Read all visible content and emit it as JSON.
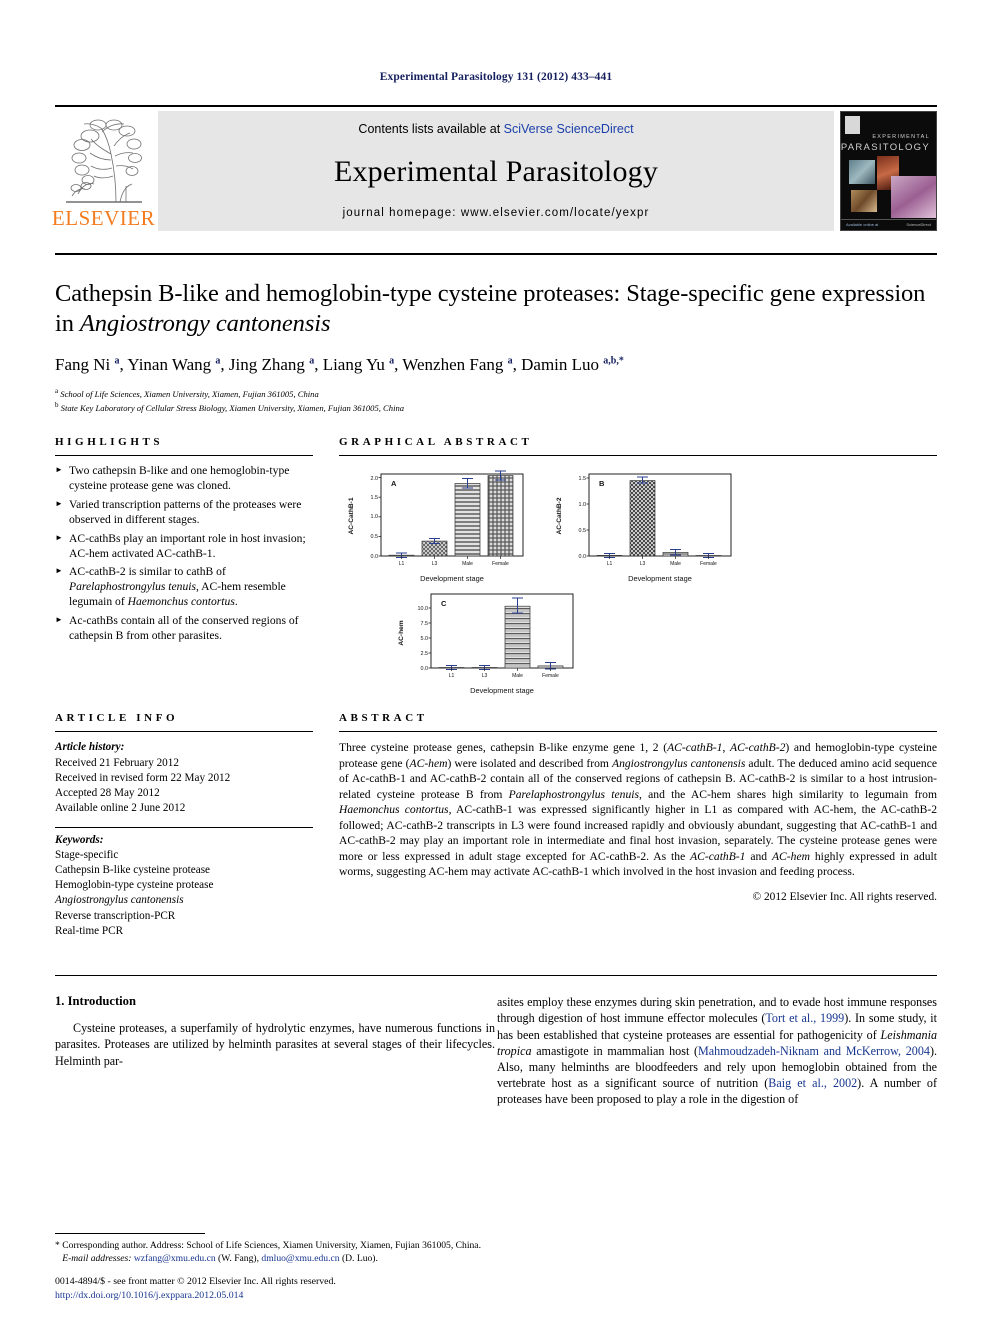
{
  "running_head": "Experimental Parasitology 131 (2012) 433–441",
  "masthead": {
    "contents_prefix": "Contents lists available at ",
    "contents_link": "SciVerse ScienceDirect",
    "journal_name": "Experimental Parasitology",
    "homepage": "journal homepage: www.elsevier.com/locate/yexpr",
    "publisher_logo_text": "ELSEVIER",
    "cover_line1": "EXPERIMENTAL",
    "cover_line2": "PARASITOLOGY",
    "cover_footer_left": "Available online at",
    "cover_footer_right": "ScienceDirect",
    "link_color": "#1a3faa",
    "logo_color": "#f47c20",
    "panel_bg": "#e6e6e6"
  },
  "article": {
    "title_part1": "Cathepsin B-like and hemoglobin-type cysteine proteases: Stage-specific gene expression in ",
    "title_italic": "Angiostrongy cantonensis",
    "authors": "Fang Ni a, Yinan Wang a, Jing Zhang a, Liang Yu a, Wenzhen Fang a, Damin Luo a,b,*",
    "affiliation_a": "School of Life Sciences, Xiamen University, Xiamen, Fujian 361005, China",
    "affiliation_b": "State Key Laboratory of Cellular Stress Biology, Xiamen University, Xiamen, Fujian 361005, China"
  },
  "highlights": {
    "heading": "HIGHLIGHTS",
    "items": [
      "Two cathepsin B-like and one hemoglobin-type cysteine protease gene was cloned.",
      "Varied transcription patterns of the proteases were observed in different stages.",
      "AC-cathBs play an important role in host invasion; AC-hem activated AC-cathB-1.",
      "AC-cathB-2 is similar to cathB of Parelaphostrongylus tenuis, AC-hem resemble legumain of Haemonchus contortus.",
      "Ac-cathBs contain all of the conserved regions of cathepsin B from other parasites."
    ]
  },
  "graphical_abstract": {
    "heading": "GRAPHICAL ABSTRACT"
  },
  "chart_data": [
    {
      "type": "bar",
      "panel": "A",
      "title": "",
      "xlabel": "Development stage",
      "ylabel": "AC-CathB-1",
      "categories": [
        "L1",
        "L3",
        "Male",
        "Female"
      ],
      "values": [
        0.02,
        0.38,
        1.85,
        2.05
      ],
      "errors": [
        0.03,
        0.06,
        0.12,
        0.12
      ],
      "ylim": [
        0.0,
        2.3
      ],
      "yticks": [
        0.0,
        0.5,
        1.0,
        1.5,
        2.0
      ],
      "ytick_labels": [
        "0.0",
        "0.5",
        "1.0",
        "1.5",
        "2.0"
      ],
      "grid": false,
      "legend": "none"
    },
    {
      "type": "bar",
      "panel": "B",
      "title": "",
      "xlabel": "Development stage",
      "ylabel": "AC-CathB-2",
      "categories": [
        "L1",
        "L3",
        "Male",
        "Female"
      ],
      "values": [
        0.01,
        1.45,
        0.07,
        0.01
      ],
      "errors": [
        0.02,
        0.05,
        0.03,
        0.02
      ],
      "ylim": [
        0.0,
        1.65
      ],
      "yticks": [
        0.0,
        0.5,
        1.0,
        1.5
      ],
      "ytick_labels": [
        "0.0",
        "0.5",
        "1.0",
        "1.5"
      ],
      "grid": false,
      "legend": "none"
    },
    {
      "type": "bar",
      "panel": "C",
      "title": "",
      "xlabel": "Development stage",
      "ylabel": "AC-hem",
      "categories": [
        "L1",
        "L3",
        "Male",
        "Female"
      ],
      "values": [
        0.02,
        0.02,
        10.3,
        0.35
      ],
      "errors": [
        0.05,
        0.05,
        0.9,
        0.25
      ],
      "ylim": [
        0.0,
        12.5
      ],
      "yticks": [
        0.0,
        2.5,
        5.0,
        7.5,
        10.0
      ],
      "ytick_labels": [
        "0.0",
        "2.5",
        "5.0",
        "7.5",
        "10.0"
      ],
      "grid": false,
      "legend": "none"
    }
  ],
  "article_info": {
    "heading": "ARTICLE INFO",
    "history_label": "Article history:",
    "history": [
      "Received 21 February 2012",
      "Received in revised form 22 May 2012",
      "Accepted 28 May 2012",
      "Available online 2 June 2012"
    ],
    "keywords_label": "Keywords:",
    "keywords": [
      "Stage-specific",
      "Cathepsin B-like cysteine protease",
      "Hemoglobin-type cysteine protease",
      "Angiostrongylus cantonensis",
      "Reverse transcription-PCR",
      "Real-time PCR"
    ],
    "keyword_italic_index": 3
  },
  "abstract": {
    "heading": "ABSTRACT",
    "text": "Three cysteine protease genes, cathepsin B-like enzyme gene 1, 2 (AC-cathB-1, AC-cathB-2) and hemoglobin-type cysteine protease gene (AC-hem) were isolated and described from Angiostrongylus cantonensis adult. The deduced amino acid sequence of Ac-cathB-1 and AC-cathB-2 contain all of the conserved regions of cathepsin B. AC-cathB-2 is similar to a host intrusion-related cysteine protease B from Parelaphostrongylus tenuis, and the AC-hem shares high similarity to legumain from Haemonchus contortus, AC-cathB-1 was expressed significantly higher in L1 as compared with AC-hem, the AC-cathB-2 followed; AC-cathB-2 transcripts in L3 were found increased rapidly and obviously abundant, suggesting that AC-cathB-1 and AC-cathB-2 may play an important role in intermediate and final host invasion, separately. The cysteine protease genes were more or less expressed in adult stage excepted for AC-cathB-2. As the AC-cathB-1 and AC-hem highly expressed in adult worms, suggesting AC-hem may activate AC-cathB-1 which involved in the host invasion and feeding process.",
    "copyright": "© 2012 Elsevier Inc. All rights reserved."
  },
  "introduction": {
    "heading": "1. Introduction",
    "left_paragraph": "Cysteine proteases, a superfamily of hydrolytic enzymes, have numerous functions in parasites. Proteases are utilized by helminth parasites at several stages of their lifecycles. Helminth par-",
    "right_paragraph": "asites employ these enzymes during skin penetration, and to evade host immune responses through digestion of host immune effector molecules (Tort et al., 1999). In some study, it has been established that cysteine proteases are essential for pathogenicity of Leishmania tropica amastigote in mammalian host (Mahmoudzadeh-Niknam and McKerrow, 2004). Also, many helminths are bloodfeeders and rely upon hemoglobin obtained from the vertebrate host as a significant source of nutrition (Baig et al., 2002). A number of proteases have been proposed to play a role in the digestion of"
  },
  "footnote": {
    "corresponding": "* Corresponding author. Address: School of Life Sciences, Xiamen University, Xiamen, Fujian 361005, China.",
    "email_label": "E-mail addresses:",
    "email_1": "wzfang@xmu.edu.cn",
    "email_1_who": "(W. Fang),",
    "email_2": "dmluo@xmu.edu.cn",
    "email_2_who": "(D. Luo)."
  },
  "footer": {
    "issn_line": "0014-4894/$ - see front matter © 2012 Elsevier Inc. All rights reserved.",
    "doi": "http://dx.doi.org/10.1016/j.exppara.2012.05.014"
  }
}
